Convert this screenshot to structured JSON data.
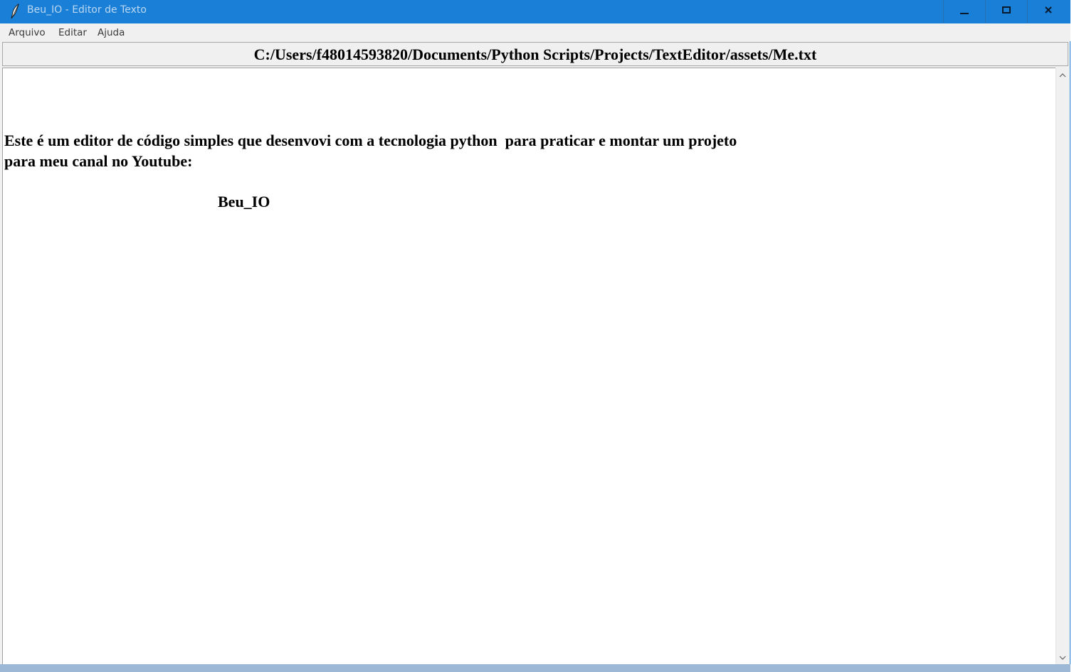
{
  "window": {
    "title": "Beu_IO - Editor de Texto",
    "accent_color": "#1a7fd7",
    "icon": "feather-icon",
    "controls": {
      "minimize_icon": "minimize-icon",
      "maximize_icon": "maximize-icon",
      "close_icon": "close-icon"
    }
  },
  "menu": {
    "items": [
      {
        "label": "Arquivo"
      },
      {
        "label": "Editar"
      },
      {
        "label": "Ajuda"
      }
    ]
  },
  "path_label": "C:/Users/f48014593820/Documents/Python Scripts/Projects/TextEditor/assets/Me.txt",
  "editor": {
    "lines": [
      "Este é um editor de código simples que desenvovi com a tecnologia python  para praticar e montar um projeto",
      "para meu canal no Youtube:",
      "Beu_IO"
    ]
  },
  "scrollbar": {
    "up_icon": "chevron-up-icon",
    "down_icon": "chevron-down-icon"
  }
}
